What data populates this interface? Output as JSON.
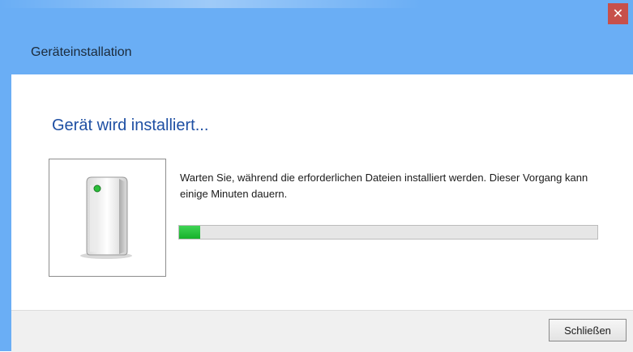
{
  "window": {
    "title": "Geräteinstallation",
    "close_icon": "close-icon",
    "accent_color": "#6aaef5",
    "close_color": "#c7504b"
  },
  "main": {
    "heading": "Gerät wird installiert...",
    "device_icon": "device-icon",
    "message": "Warten Sie, während die erforderlichen Dateien installiert werden. Dieser Vorgang kann einige Minuten dauern.",
    "progress_percent": 5,
    "progress_color": "#16b12a"
  },
  "footer": {
    "close_button_label": "Schließen"
  }
}
